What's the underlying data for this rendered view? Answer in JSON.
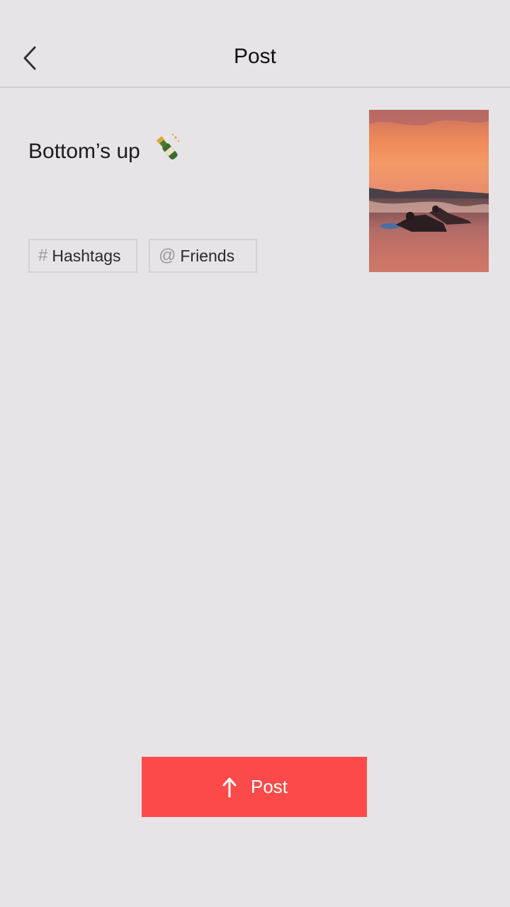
{
  "header": {
    "back_icon": "chevron-left-icon",
    "title": "Post"
  },
  "composer": {
    "caption": "Bottom’s up",
    "caption_emoji": "champagne-bottle-icon",
    "media_thumbnail": "sunset-surfers-photo"
  },
  "tags": {
    "hashtags_icon": "#",
    "hashtags_label": "Hashtags",
    "friends_icon": "@",
    "friends_label": "Friends"
  },
  "footer": {
    "post_icon": "arrow-up-icon",
    "post_label": "Post",
    "post_color": "#fc4a4a"
  },
  "colors": {
    "background": "#e6e4e6",
    "divider": "#cfcdcf",
    "text": "#1c1c1c"
  }
}
